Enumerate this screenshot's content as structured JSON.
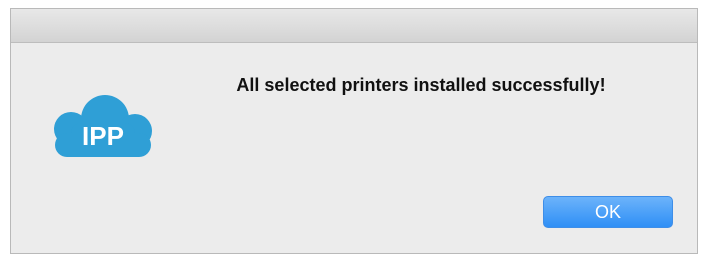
{
  "dialog": {
    "icon": {
      "name": "ipp-cloud-icon",
      "label": "IPP",
      "color": "#2f9fd6"
    },
    "message": "All selected printers installed successfully!",
    "ok_label": "OK",
    "ok_button_color": "#2f8ff6"
  }
}
